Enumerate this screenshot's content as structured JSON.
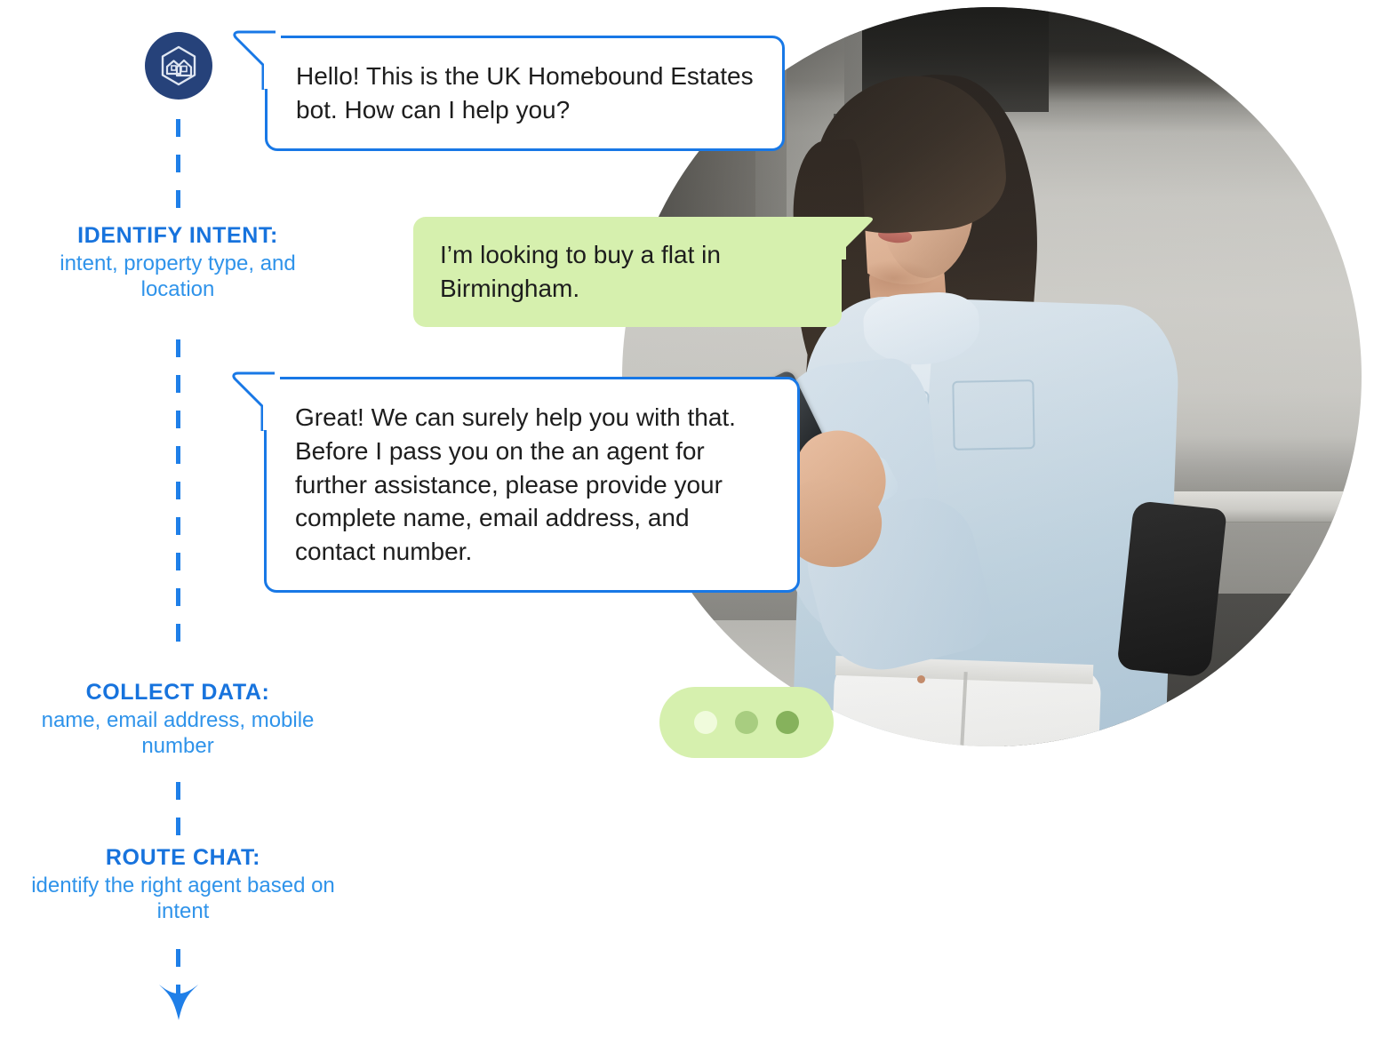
{
  "illustration": {
    "title": "Chatbot conversation flow for UK Homebound Estates"
  },
  "brand": {
    "logo_icon": "hexagon-houses-logo-icon",
    "logo_bg_color": "#26427a",
    "accent_blue": "#1878e6",
    "label_blue": "#2f93ea",
    "bubble_green": "#d6f0ae"
  },
  "flow": {
    "steps": [
      {
        "id": "identify-intent",
        "title": "IDENTIFY INTENT:",
        "description": "intent, property type,\nand location"
      },
      {
        "id": "collect-data",
        "title": "COLLECT DATA:",
        "description": "name, email address,\nmobile number"
      },
      {
        "id": "route-chat",
        "title": "ROUTE CHAT:",
        "description": "identify the right\nagent based on intent"
      }
    ],
    "connector_icon": "dashed-line-connector",
    "arrow_icon": "arrow-down-icon"
  },
  "chat": {
    "messages": [
      {
        "id": "bot-greeting",
        "sender": "bot",
        "text": "Hello! This is the UK Homebound Estates bot. How can I help you?"
      },
      {
        "id": "user-intent",
        "sender": "user",
        "text": "I’m looking to buy a flat in Birmingham."
      },
      {
        "id": "bot-collect",
        "sender": "bot",
        "text": "Great! We can surely help you with that. Before I pass you on the an agent for further assistance, please provide your complete name, email address, and contact number."
      }
    ],
    "typing_indicator": {
      "id": "typing-indicator",
      "icon": "typing-dots-icon",
      "dots": 3
    }
  },
  "photo": {
    "alt": "Woman in light blue denim shirt and white jeans using a smartphone",
    "mask": "circle"
  }
}
